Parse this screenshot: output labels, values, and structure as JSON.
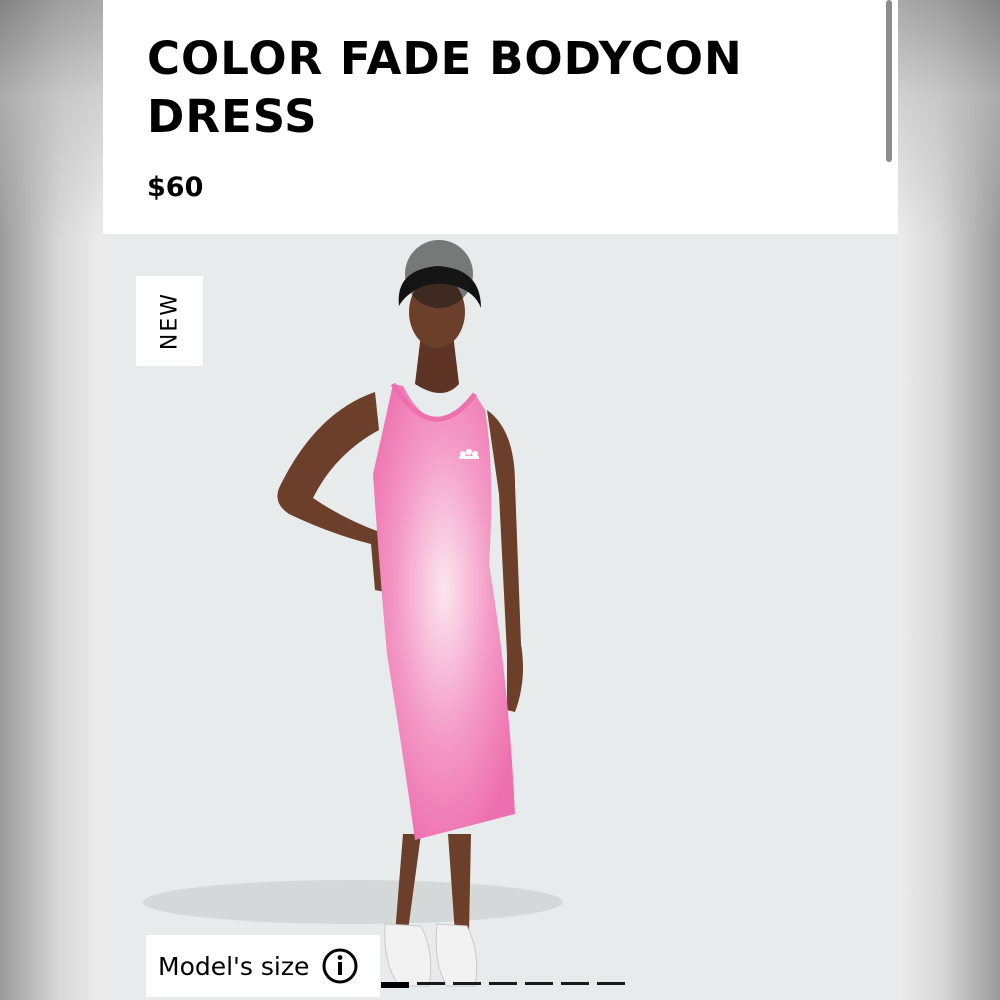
{
  "product": {
    "title": "COLOR FADE BODYCON DRESS",
    "price": "$60",
    "badge": "NEW",
    "model_size_label": "Model's size",
    "image_slides": 7,
    "active_slide": 1
  },
  "colors": {
    "dress_pink": "#f07bb4",
    "image_background": "#e8ebeb",
    "text": "#000000"
  },
  "icons": {
    "info": "info-circle-icon",
    "brand": "trefoil-logo"
  }
}
